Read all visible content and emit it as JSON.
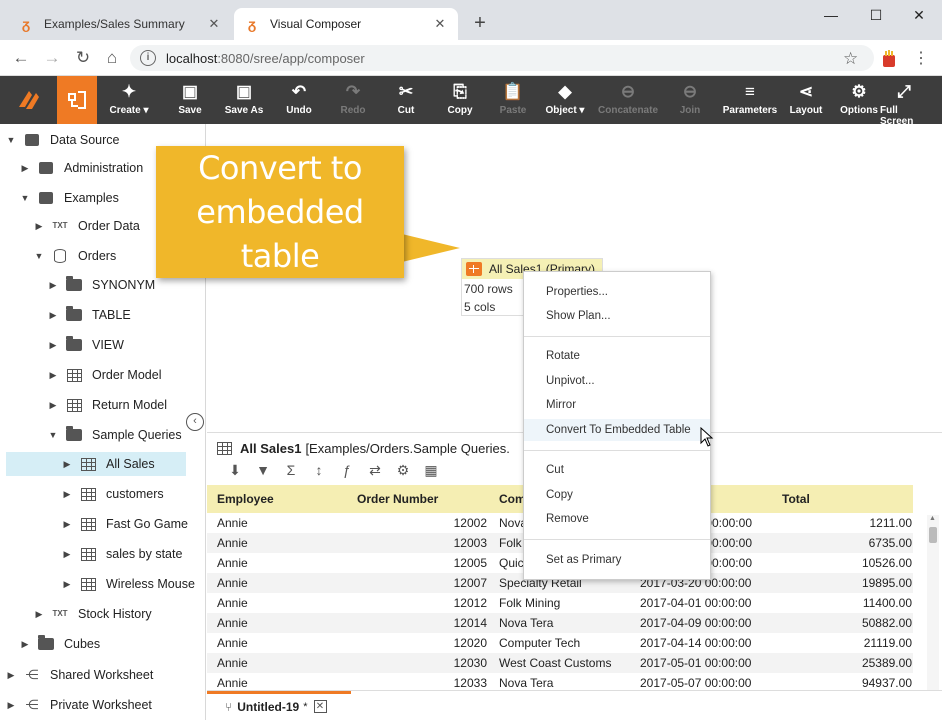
{
  "browser": {
    "tabs": [
      {
        "title": "Examples/Sales Summary",
        "close": "✕"
      },
      {
        "title": "Visual Composer",
        "close": "✕"
      }
    ],
    "new_tab": "+",
    "window_buttons": {
      "minimize": "—",
      "maximize": "☐",
      "close": "✕"
    },
    "url_host": "localhost",
    "url_rest": ":8080/sree/app/composer",
    "nav": {
      "back": "←",
      "forward": "→",
      "reload": "↻",
      "home": "⌂"
    }
  },
  "toolbar": {
    "buttons": [
      {
        "label": "Create ▾",
        "icon": "✦"
      },
      {
        "label": "Save",
        "icon": "▣"
      },
      {
        "label": "Save As",
        "icon": "▣"
      },
      {
        "label": "Undo",
        "icon": "↶"
      },
      {
        "label": "Redo",
        "icon": "↷"
      },
      {
        "label": "Cut",
        "icon": "✂"
      },
      {
        "label": "Copy",
        "icon": "⎘"
      },
      {
        "label": "Paste",
        "icon": "📋"
      },
      {
        "label": "Object ▾",
        "icon": "◆"
      },
      {
        "label": "Concatenate",
        "icon": "⊖"
      },
      {
        "label": "Join",
        "icon": "⊖"
      },
      {
        "label": "Parameters",
        "icon": "≡"
      },
      {
        "label": "Layout",
        "icon": "⋖"
      },
      {
        "label": "Options",
        "icon": "⚙"
      },
      {
        "label": "Full Screen",
        "icon": "⤢"
      }
    ]
  },
  "tree": {
    "items": [
      {
        "label": "Data Source"
      },
      {
        "label": "Administration"
      },
      {
        "label": "Examples"
      },
      {
        "label": "Order Data"
      },
      {
        "label": "Orders"
      },
      {
        "label": "SYNONYM"
      },
      {
        "label": "TABLE"
      },
      {
        "label": "VIEW"
      },
      {
        "label": "Order Model"
      },
      {
        "label": "Return Model"
      },
      {
        "label": "Sample Queries"
      },
      {
        "label": "All Sales"
      },
      {
        "label": "customers"
      },
      {
        "label": "Fast Go Game"
      },
      {
        "label": "sales by state"
      },
      {
        "label": "Wireless Mouse"
      },
      {
        "label": "Stock History"
      },
      {
        "label": "Cubes"
      },
      {
        "label": "Shared Worksheet"
      },
      {
        "label": "Private Worksheet"
      }
    ],
    "txt_badge": "TXT",
    "collapse_glyph": "‹"
  },
  "canvas": {
    "callout_line1": "Convert to",
    "callout_line2": "embedded table",
    "block_title": "All Sales1 (Primary)",
    "block_rows": "700 rows",
    "block_cols": "5 cols"
  },
  "context_menu": {
    "items": [
      "Properties...",
      "Show Plan...",
      "Rotate",
      "Unpivot...",
      "Mirror",
      "Convert To Embedded Table",
      "Cut",
      "Copy",
      "Remove",
      "Set as Primary"
    ]
  },
  "data_pane": {
    "title_name": "All Sales1",
    "title_path": "[Examples/Orders.Sample Queries.",
    "tool_icons": [
      "⬇",
      "▼",
      "Σ",
      "↕",
      "ƒ",
      "⇄",
      "⚙",
      "▦"
    ],
    "columns": [
      "Employee",
      "Order Number",
      "Com",
      "Total"
    ],
    "rows": [
      [
        "Annie",
        "12002",
        "Nova",
        "00:00:00",
        "1211.00"
      ],
      [
        "Annie",
        "12003",
        "Folk",
        "00:00:00",
        "6735.00"
      ],
      [
        "Annie",
        "12005",
        "Quic",
        "00:00:00",
        "10526.00"
      ],
      [
        "Annie",
        "12007",
        "Specialty Retail",
        "2017-03-20 00:00:00",
        "19895.00"
      ],
      [
        "Annie",
        "12012",
        "Folk Mining",
        "2017-04-01 00:00:00",
        "11400.00"
      ],
      [
        "Annie",
        "12014",
        "Nova Tera",
        "2017-04-09 00:00:00",
        "50882.00"
      ],
      [
        "Annie",
        "12020",
        "Computer Tech",
        "2017-04-14 00:00:00",
        "21119.00"
      ],
      [
        "Annie",
        "12030",
        "West Coast Customs",
        "2017-05-01 00:00:00",
        "25389.00"
      ],
      [
        "Annie",
        "12033",
        "Nova Tera",
        "2017-05-07 00:00:00",
        "94937.00"
      ]
    ]
  },
  "bottom_tab": {
    "name": "Untitled-19",
    "modified": "*",
    "close": "✕"
  },
  "colors": {
    "accent": "#ef7a24",
    "toolbar_bg": "#3d3d3d",
    "callout": "#f0b72a",
    "grid_header": "#f5eeb3",
    "selection": "#d6eef6"
  }
}
